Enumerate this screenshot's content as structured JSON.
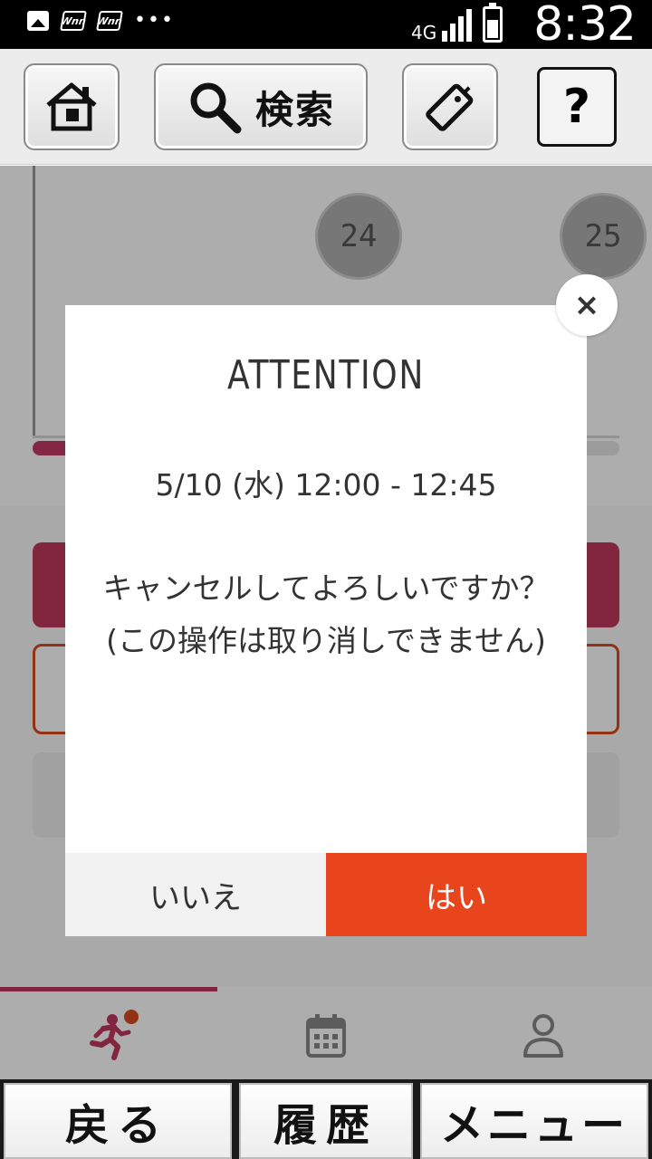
{
  "status_bar": {
    "network": "4G",
    "time": "8:32",
    "notification_icons": [
      "image-icon",
      "wnn-icon",
      "wnn-icon",
      "more-dots-icon"
    ]
  },
  "toolbar": {
    "home_icon": "home-icon",
    "search_label": "検索",
    "tag_icon": "tag-icon",
    "help_label": "?"
  },
  "calendar": {
    "days": [
      "24",
      "25"
    ]
  },
  "dialog": {
    "title": "ATTENTION",
    "datetime": "5/10 (水) 12:00 - 12:45",
    "message": "キャンセルしてよろしいですか？(この操作は取り消しできません)",
    "no_label": "いいえ",
    "yes_label": "はい",
    "close_label": "×"
  },
  "tabbar": {
    "tabs": [
      {
        "icon": "running-person-icon",
        "active": true
      },
      {
        "icon": "calendar-icon",
        "active": false
      },
      {
        "icon": "person-icon",
        "active": false
      }
    ]
  },
  "hardware_keys": {
    "back_label": "戻る",
    "history_label": "履歴",
    "menu_label": "メニュー"
  },
  "colors": {
    "accent_pink": "#c0395f",
    "confirm_orange": "#e8451c",
    "notification_dot": "#d44a1c"
  }
}
